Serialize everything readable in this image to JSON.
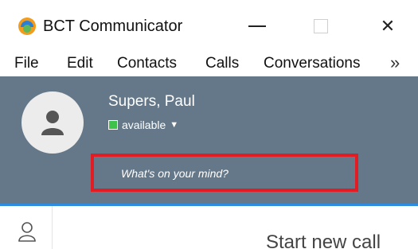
{
  "window": {
    "title": "BCT Communicator",
    "minimize_icon": "minimize-icon",
    "maximize_icon": "maximize-icon",
    "close_icon": "close-icon",
    "close_glyph": "✕"
  },
  "menubar": {
    "items": [
      "File",
      "Edit",
      "Contacts",
      "Calls",
      "Conversations"
    ],
    "overflow_glyph": "»"
  },
  "profile": {
    "name": "Supers, Paul",
    "status": "available",
    "status_caret": "▼",
    "status_color": "#3fc24b",
    "mind_placeholder": "What's on your mind?",
    "mind_value": "",
    "panel_color": "#657889",
    "highlight_color": "#e31b23"
  },
  "main": {
    "start_call": "Start new call"
  }
}
